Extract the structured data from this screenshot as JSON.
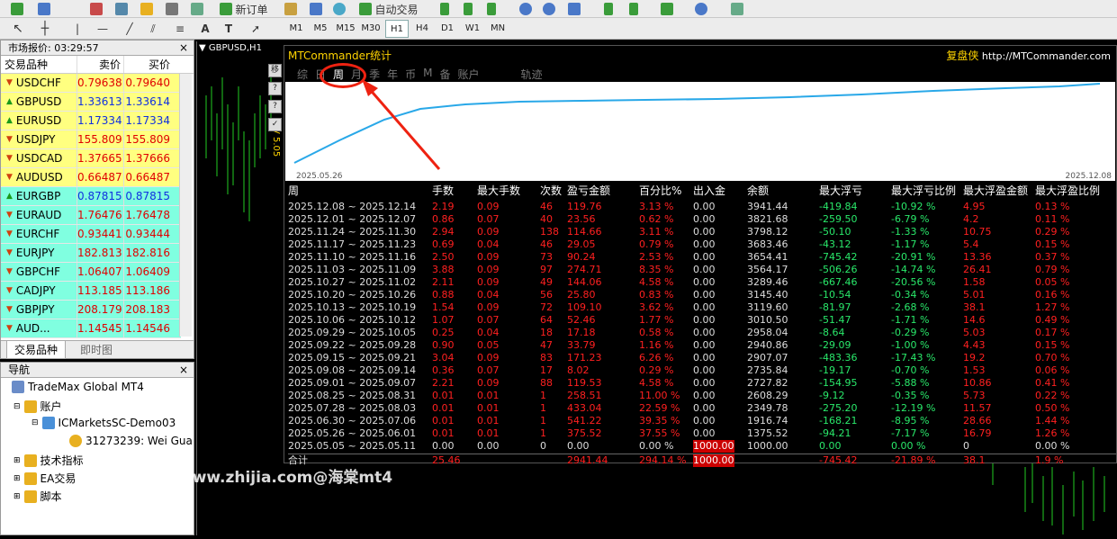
{
  "toolbar": {
    "new_order": "新订单",
    "autotrade": "自动交易",
    "timeframes": [
      "M1",
      "M5",
      "M15",
      "M30",
      "H1",
      "H4",
      "D1",
      "W1",
      "MN"
    ],
    "active_tf": "H1"
  },
  "market_watch": {
    "title": "市场报价: 03:29:57",
    "col_symbol": "交易品种",
    "col_bid": "卖价",
    "col_ask": "买价",
    "rows": [
      {
        "sym": "USDCHF",
        "bid": "0.79638",
        "ask": "0.79640",
        "dir": "down",
        "bg": "#ffff80",
        "color": "#e00000"
      },
      {
        "sym": "GBPUSD",
        "bid": "1.33613",
        "ask": "1.33614",
        "dir": "up",
        "bg": "#ffff80",
        "color": "#1030e0"
      },
      {
        "sym": "EURUSD",
        "bid": "1.17334",
        "ask": "1.17334",
        "dir": "up",
        "bg": "#ffff80",
        "color": "#1030e0"
      },
      {
        "sym": "USDJPY",
        "bid": "155.809",
        "ask": "155.809",
        "dir": "down",
        "bg": "#ffff80",
        "color": "#e00000"
      },
      {
        "sym": "USDCAD",
        "bid": "1.37665",
        "ask": "1.37666",
        "dir": "down",
        "bg": "#ffff80",
        "color": "#e00000"
      },
      {
        "sym": "AUDUSD",
        "bid": "0.66487",
        "ask": "0.66487",
        "dir": "down",
        "bg": "#ffff80",
        "color": "#e00000"
      },
      {
        "sym": "EURGBP",
        "bid": "0.87815",
        "ask": "0.87815",
        "dir": "up",
        "bg": "#80ffe0",
        "color": "#1030e0"
      },
      {
        "sym": "EURAUD",
        "bid": "1.76476",
        "ask": "1.76478",
        "dir": "down",
        "bg": "#80ffe0",
        "color": "#e00000"
      },
      {
        "sym": "EURCHF",
        "bid": "0.93441",
        "ask": "0.93444",
        "dir": "down",
        "bg": "#80ffe0",
        "color": "#e00000"
      },
      {
        "sym": "EURJPY",
        "bid": "182.813",
        "ask": "182.816",
        "dir": "down",
        "bg": "#80ffe0",
        "color": "#e00000"
      },
      {
        "sym": "GBPCHF",
        "bid": "1.06407",
        "ask": "1.06409",
        "dir": "down",
        "bg": "#80ffe0",
        "color": "#e00000"
      },
      {
        "sym": "CADJPY",
        "bid": "113.185",
        "ask": "113.186",
        "dir": "down",
        "bg": "#80ffe0",
        "color": "#e00000"
      },
      {
        "sym": "GBPJPY",
        "bid": "208.179",
        "ask": "208.183",
        "dir": "down",
        "bg": "#80ffe0",
        "color": "#e00000"
      },
      {
        "sym": "AUD...",
        "bid": "1.14545",
        "ask": "1.14546",
        "dir": "down",
        "bg": "#80ffe0",
        "color": "#e00000"
      }
    ],
    "tab_symbols": "交易品种",
    "tab_tick": "即时图"
  },
  "navigator": {
    "title": "导航",
    "root": "TradeMax Global MT4",
    "accounts": "账户",
    "server": "ICMarketsSC-Demo03",
    "user": "31273239: Wei Gua",
    "indicators": "技术指标",
    "ea": "EA交易",
    "scripts": "脚本"
  },
  "chart": {
    "tab": "GBPUSD,H1",
    "side_label": "V 5.05"
  },
  "panel": {
    "title": "MTCommander统计",
    "brand": "复盘侠",
    "url": "http://MTCommander.com",
    "tabs": [
      "综",
      "日",
      "周",
      "月",
      "季",
      "年",
      "币",
      "M",
      "备",
      "账户",
      "",
      "轨迹"
    ],
    "graph_start": "2025.05.26",
    "graph_end": "2025.12.08",
    "headers": [
      "周",
      "手数",
      "最大手数",
      "次数",
      "盈亏金额",
      "百分比%",
      "出入金",
      "余额",
      "最大浮亏",
      "最大浮亏比例",
      "最大浮盈金额",
      "最大浮盈比例"
    ],
    "rows": [
      [
        "2025.12.08 ~ 2025.12.14",
        "2.19",
        "0.09",
        "46",
        "119.76",
        "3.13 %",
        "0.00",
        "3941.44",
        "-419.84",
        "-10.92 %",
        "4.95",
        "0.13 %"
      ],
      [
        "2025.12.01 ~ 2025.12.07",
        "0.86",
        "0.07",
        "40",
        "23.56",
        "0.62 %",
        "0.00",
        "3821.68",
        "-259.50",
        "-6.79 %",
        "4.2",
        "0.11 %"
      ],
      [
        "2025.11.24 ~ 2025.11.30",
        "2.94",
        "0.09",
        "138",
        "114.66",
        "3.11 %",
        "0.00",
        "3798.12",
        "-50.10",
        "-1.33 %",
        "10.75",
        "0.29 %"
      ],
      [
        "2025.11.17 ~ 2025.11.23",
        "0.69",
        "0.04",
        "46",
        "29.05",
        "0.79 %",
        "0.00",
        "3683.46",
        "-43.12",
        "-1.17 %",
        "5.4",
        "0.15 %"
      ],
      [
        "2025.11.10 ~ 2025.11.16",
        "2.50",
        "0.09",
        "73",
        "90.24",
        "2.53 %",
        "0.00",
        "3654.41",
        "-745.42",
        "-20.91 %",
        "13.36",
        "0.37 %"
      ],
      [
        "2025.11.03 ~ 2025.11.09",
        "3.88",
        "0.09",
        "97",
        "274.71",
        "8.35 %",
        "0.00",
        "3564.17",
        "-506.26",
        "-14.74 %",
        "26.41",
        "0.79 %"
      ],
      [
        "2025.10.27 ~ 2025.11.02",
        "2.11",
        "0.09",
        "49",
        "144.06",
        "4.58 %",
        "0.00",
        "3289.46",
        "-667.46",
        "-20.56 %",
        "1.58",
        "0.05 %"
      ],
      [
        "2025.10.20 ~ 2025.10.26",
        "0.88",
        "0.04",
        "56",
        "25.80",
        "0.83 %",
        "0.00",
        "3145.40",
        "-10.54",
        "-0.34 %",
        "5.01",
        "0.16 %"
      ],
      [
        "2025.10.13 ~ 2025.10.19",
        "1.54",
        "0.09",
        "72",
        "109.10",
        "3.62 %",
        "0.00",
        "3119.60",
        "-81.97",
        "-2.68 %",
        "38.1",
        "1.27 %"
      ],
      [
        "2025.10.06 ~ 2025.10.12",
        "1.07",
        "0.07",
        "64",
        "52.46",
        "1.77 %",
        "0.00",
        "3010.50",
        "-51.47",
        "-1.71 %",
        "14.6",
        "0.49 %"
      ],
      [
        "2025.09.29 ~ 2025.10.05",
        "0.25",
        "0.04",
        "18",
        "17.18",
        "0.58 %",
        "0.00",
        "2958.04",
        "-8.64",
        "-0.29 %",
        "5.03",
        "0.17 %"
      ],
      [
        "2025.09.22 ~ 2025.09.28",
        "0.90",
        "0.05",
        "47",
        "33.79",
        "1.16 %",
        "0.00",
        "2940.86",
        "-29.09",
        "-1.00 %",
        "4.43",
        "0.15 %"
      ],
      [
        "2025.09.15 ~ 2025.09.21",
        "3.04",
        "0.09",
        "83",
        "171.23",
        "6.26 %",
        "0.00",
        "2907.07",
        "-483.36",
        "-17.43 %",
        "19.2",
        "0.70 %"
      ],
      [
        "2025.09.08 ~ 2025.09.14",
        "0.36",
        "0.07",
        "17",
        "8.02",
        "0.29 %",
        "0.00",
        "2735.84",
        "-19.17",
        "-0.70 %",
        "1.53",
        "0.06 %"
      ],
      [
        "2025.09.01 ~ 2025.09.07",
        "2.21",
        "0.09",
        "88",
        "119.53",
        "4.58 %",
        "0.00",
        "2727.82",
        "-154.95",
        "-5.88 %",
        "10.86",
        "0.41 %"
      ],
      [
        "2025.08.25 ~ 2025.08.31",
        "0.01",
        "0.01",
        "1",
        "258.51",
        "11.00 %",
        "0.00",
        "2608.29",
        "-9.12",
        "-0.35 %",
        "5.73",
        "0.22 %"
      ],
      [
        "2025.07.28 ~ 2025.08.03",
        "0.01",
        "0.01",
        "1",
        "433.04",
        "22.59 %",
        "0.00",
        "2349.78",
        "-275.20",
        "-12.19 %",
        "11.57",
        "0.50 %"
      ],
      [
        "2025.06.30 ~ 2025.07.06",
        "0.01",
        "0.01",
        "1",
        "541.22",
        "39.35 %",
        "0.00",
        "1916.74",
        "-168.21",
        "-8.95 %",
        "28.66",
        "1.44 %"
      ],
      [
        "2025.05.26 ~ 2025.06.01",
        "0.01",
        "0.01",
        "1",
        "375.52",
        "37.55 %",
        "0.00",
        "1375.52",
        "-94.21",
        "-7.17 %",
        "16.79",
        "1.26 %"
      ],
      [
        "2025.05.05 ~ 2025.05.11",
        "0.00",
        "0.00",
        "0",
        "0.00",
        "0.00 %",
        "1000.00",
        "1000.00",
        "0.00",
        "0.00 %",
        "0",
        "0.00 %"
      ]
    ],
    "total": [
      "合计",
      "25.46",
      "",
      "",
      "2941.44",
      "294.14 %",
      "1000.00",
      "",
      "-745.42",
      "-21.89 %",
      "38.1",
      "1.9 %"
    ]
  },
  "watermark": "www.zhijia.com@海棠mt4"
}
